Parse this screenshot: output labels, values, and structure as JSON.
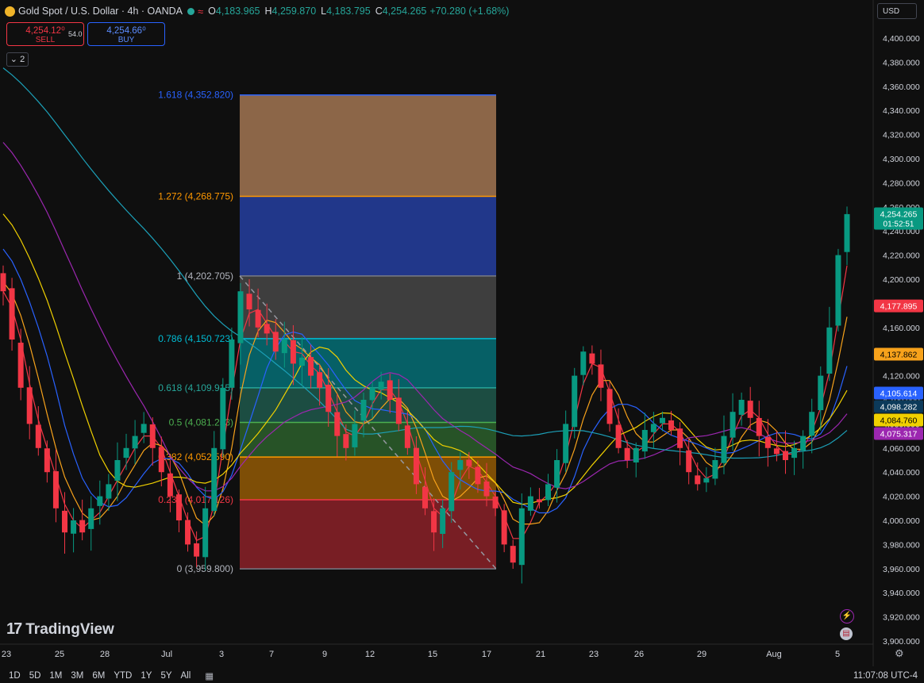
{
  "header": {
    "symbol": "Gold Spot / U.S. Dollar · 4h · OANDA",
    "open_label": "O",
    "open": "4,183.965",
    "high_label": "H",
    "high": "4,259.870",
    "low_label": "L",
    "low": "4,183.795",
    "close_label": "C",
    "close": "4,254.265",
    "change": "+70.280 (+1.68%)"
  },
  "trade": {
    "sell_price": "4,254.12⁰",
    "sell_label": "SELL",
    "spread": "54.0",
    "buy_price": "4,254.66⁰",
    "buy_label": "BUY"
  },
  "indicator_collapse": "2",
  "currency": "USD",
  "branding": "TradingView",
  "bottom_bar": {
    "ranges": [
      "1D",
      "5D",
      "1M",
      "3M",
      "6M",
      "YTD",
      "1Y",
      "5Y",
      "All"
    ],
    "clock": "11:07:08 UTC-4"
  },
  "icons": [
    "gold-icon",
    "lightning-icon",
    "us-flag-icon",
    "calendar-icon",
    "gear-icon"
  ],
  "chart_data": {
    "type": "candlestick",
    "ylim": [
      3895,
      4405
    ],
    "y_ticks": [
      "4,400.000",
      "4,380.000",
      "4,360.000",
      "4,340.000",
      "4,320.000",
      "4,300.000",
      "4,280.000",
      "4,260.000",
      "4,240.000",
      "4,220.000",
      "4,200.000",
      "4,180.000",
      "4,160.000",
      "4,140.000",
      "4,120.000",
      "4,100.000",
      "4,080.000",
      "4,060.000",
      "4,040.000",
      "4,020.000",
      "4,000.000",
      "3,980.000",
      "3,960.000",
      "3,940.000",
      "3,920.000",
      "3,900.000"
    ],
    "x_ticks": [
      "23",
      "25",
      "28",
      "Jul",
      "3",
      "7",
      "9",
      "12",
      "15",
      "17",
      "21",
      "23",
      "26",
      "29",
      "Aug",
      "5"
    ],
    "closes": [
      4190,
      4150,
      4110,
      4080,
      4060,
      4040,
      4010,
      3990,
      4000,
      3990,
      4010,
      4020,
      4030,
      4050,
      4060,
      4070,
      4080,
      4060,
      4040,
      4020,
      4000,
      3980,
      3970,
      4010,
      4060,
      4110,
      4150,
      4190,
      4175,
      4160,
      4155,
      4140,
      4150,
      4130,
      4135,
      4120,
      4110,
      4090,
      4070,
      4060,
      4080,
      4100,
      4110,
      4115,
      4100,
      4080,
      4060,
      4030,
      4010,
      3990,
      4010,
      4040,
      4050,
      4045,
      4030,
      4020,
      4010,
      3980,
      3965,
      4010,
      4020,
      4015,
      4030,
      4050,
      4080,
      4120,
      4140,
      4130,
      4110,
      4080,
      4060,
      4050,
      4060,
      4075,
      4080,
      4085,
      4075,
      4060,
      4040,
      4030,
      4035,
      4050,
      4070,
      4090,
      4100,
      4085,
      4070,
      4060,
      4055,
      4050,
      4060,
      4070,
      4090,
      4120,
      4160,
      4220,
      4254
    ],
    "price_labels": [
      {
        "text": "4,254.265",
        "sub": "01:52:51",
        "color": "#089981",
        "value": 4254.265
      },
      {
        "text": "4,177.895",
        "color": "#f23645",
        "value": 4177.895
      },
      {
        "text": "4,137.862",
        "color": "#f7a21b",
        "value": 4137.862
      },
      {
        "text": "4,105.614",
        "color": "#2962ff",
        "value": 4105.614
      },
      {
        "text": "4,098.282",
        "color": "#0c3a5a",
        "value": 4098.282
      },
      {
        "text": "4,084.760",
        "color": "#f0d000",
        "value": 4084.76
      },
      {
        "text": "4,075.317",
        "color": "#9c27b0",
        "value": 4075.317
      }
    ],
    "fib_levels": [
      {
        "ratio": "1.618 (4,352.820)",
        "value": 4352.82,
        "line": "#2962ff",
        "fill": "rgba(244,174,120,0.55)"
      },
      {
        "ratio": "1.272 (4,268.775)",
        "value": 4268.775,
        "line": "#ff9800",
        "fill": "rgba(40,70,180,0.75)"
      },
      {
        "ratio": "1 (4,202.705)",
        "value": 4202.705,
        "line": "#787b86",
        "fill": "rgba(110,110,110,0.5)"
      },
      {
        "ratio": "0.786 (4,150.723)",
        "value": 4150.723,
        "line": "#00bcd4",
        "fill": "rgba(0,150,160,0.6)"
      },
      {
        "ratio": "0.618 (4,109.915)",
        "value": 4109.915,
        "line": "#26a69a",
        "fill": "rgba(40,130,110,0.55)"
      },
      {
        "ratio": "0.5 (4,081.253)",
        "value": 4081.253,
        "line": "#4caf50",
        "fill": "rgba(60,140,60,0.55)"
      },
      {
        "ratio": "0.382 (4,052.590)",
        "value": 4052.59,
        "line": "#ff9800",
        "fill": "rgba(200,120,0,0.6)"
      },
      {
        "ratio": "0.236 (4,017.126)",
        "value": 4017.126,
        "line": "#f23645",
        "fill": "rgba(190,40,50,0.6)"
      },
      {
        "ratio": "0 (3,959.800)",
        "value": 3959.8,
        "line": "#787b86",
        "fill": ""
      }
    ],
    "colors": {
      "up": "#089981",
      "down": "#f23645",
      "background": "#0f0f0f",
      "grid": "#1e1e1e",
      "axis_text": "#d1d4dc"
    }
  }
}
